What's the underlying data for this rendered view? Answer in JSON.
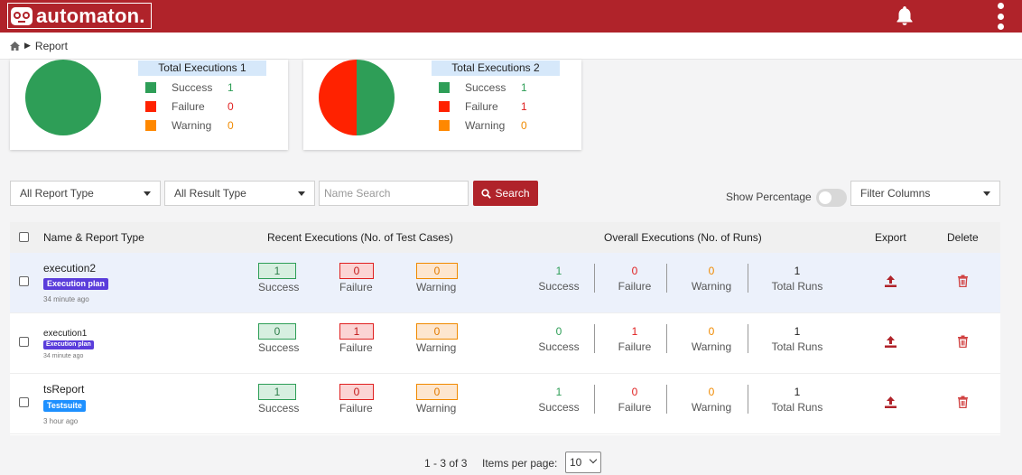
{
  "app": {
    "logo_text": "automaton."
  },
  "breadcrumb": {
    "current": "Report"
  },
  "summary_cards": [
    {
      "title": "Total Executions 1",
      "pie": {
        "success": 1,
        "failure": 0,
        "warning": 0
      },
      "legend": [
        {
          "label": "Success",
          "value": "1",
          "color": "#2e9e57"
        },
        {
          "label": "Failure",
          "value": "0",
          "color": "#ff2200"
        },
        {
          "label": "Warning",
          "value": "0",
          "color": "#ff8800"
        }
      ]
    },
    {
      "title": "Total Executions 2",
      "pie": {
        "success": 1,
        "failure": 1,
        "warning": 0
      },
      "legend": [
        {
          "label": "Success",
          "value": "1",
          "color": "#2e9e57"
        },
        {
          "label": "Failure",
          "value": "1",
          "color": "#ff2200"
        },
        {
          "label": "Warning",
          "value": "0",
          "color": "#ff8800"
        }
      ]
    }
  ],
  "filters": {
    "report_type": "All Report Type",
    "result_type": "All Result Type",
    "search_placeholder": "Name Search",
    "search_label": "Search",
    "show_percentage_label": "Show Percentage",
    "filter_columns": "Filter Columns"
  },
  "table": {
    "headers": {
      "name": "Name & Report Type",
      "recent": "Recent Executions (No. of Test Cases)",
      "overall": "Overall Executions (No. of Runs)",
      "export": "Export",
      "delete": "Delete"
    },
    "status_labels": {
      "success": "Success",
      "failure": "Failure",
      "warning": "Warning",
      "total_runs": "Total Runs"
    },
    "rows": [
      {
        "name": "execution2",
        "type": "Execution plan",
        "time": "34 minute ago",
        "recent": {
          "success": "1",
          "failure": "0",
          "warning": "0"
        },
        "overall": {
          "success": "1",
          "failure": "0",
          "warning": "0",
          "total_runs": "1"
        }
      },
      {
        "name": "execution1",
        "type": "Execution plan",
        "time": "34 minute ago",
        "recent": {
          "success": "0",
          "failure": "1",
          "warning": "0"
        },
        "overall": {
          "success": "0",
          "failure": "1",
          "warning": "0",
          "total_runs": "1"
        }
      },
      {
        "name": "tsReport",
        "type": "Testsuite",
        "time": "3 hour ago",
        "recent": {
          "success": "1",
          "failure": "0",
          "warning": "0"
        },
        "overall": {
          "success": "1",
          "failure": "0",
          "warning": "0",
          "total_runs": "1"
        }
      }
    ]
  },
  "pagination": {
    "range": "1 - 3 of 3",
    "items_per_page_label": "Items per page:",
    "items_per_page": "10"
  },
  "icons": {
    "logo": "automaton-logo-icon",
    "bell": "bell-icon",
    "menu": "kebab-menu-icon",
    "home": "home-icon",
    "search": "search-icon",
    "export": "upload-icon",
    "delete": "trash-icon"
  },
  "colors": {
    "brand": "#b0232a",
    "success": "#2e9e57",
    "failure": "#e02020",
    "warning": "#f08a00",
    "tag_plan": "#5a3ddb",
    "tag_suite": "#1e90ff"
  }
}
